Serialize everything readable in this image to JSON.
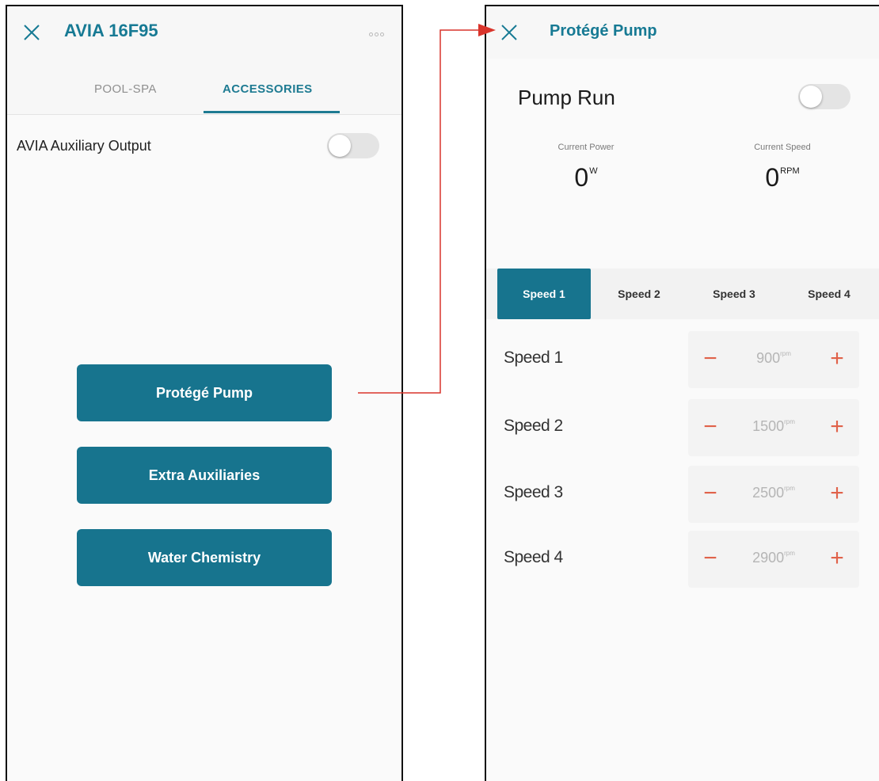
{
  "left_screen": {
    "title": "AVIA 16F95",
    "tabs": [
      {
        "label": "POOL-SPA",
        "active": false
      },
      {
        "label": "ACCESSORIES",
        "active": true
      }
    ],
    "aux_output": {
      "label": "AVIA Auxiliary Output",
      "on": false
    },
    "buttons": [
      {
        "label": "Protégé Pump"
      },
      {
        "label": "Extra Auxiliaries"
      },
      {
        "label": "Water Chemistry"
      }
    ]
  },
  "right_screen": {
    "title": "Protégé Pump",
    "pump_run": {
      "label": "Pump Run",
      "on": false
    },
    "current_power": {
      "label": "Current Power",
      "value": "0",
      "unit": "W"
    },
    "current_speed": {
      "label": "Current Speed",
      "value": "0",
      "unit": "RPM"
    },
    "speed_tabs": [
      {
        "label": "Speed 1",
        "active": true
      },
      {
        "label": "Speed 2",
        "active": false
      },
      {
        "label": "Speed 3",
        "active": false
      },
      {
        "label": "Speed 4",
        "active": false
      }
    ],
    "speeds": [
      {
        "label": "Speed 1",
        "value": "900",
        "unit": "rpm"
      },
      {
        "label": "Speed 2",
        "value": "1500",
        "unit": "rpm"
      },
      {
        "label": "Speed 3",
        "value": "2500",
        "unit": "rpm"
      },
      {
        "label": "Speed 4",
        "value": "2900",
        "unit": "rpm"
      }
    ],
    "minus_symbol": "−",
    "plus_symbol": "+"
  },
  "colors": {
    "accent": "#17748e",
    "title": "#177a94",
    "stepper_symbols": "#e0624a",
    "connector_arrow": "#d9342b",
    "frame_border": "#111111"
  },
  "icons": {
    "close": "close-icon",
    "more": "more-icon",
    "arrow": "arrow-right-icon"
  }
}
